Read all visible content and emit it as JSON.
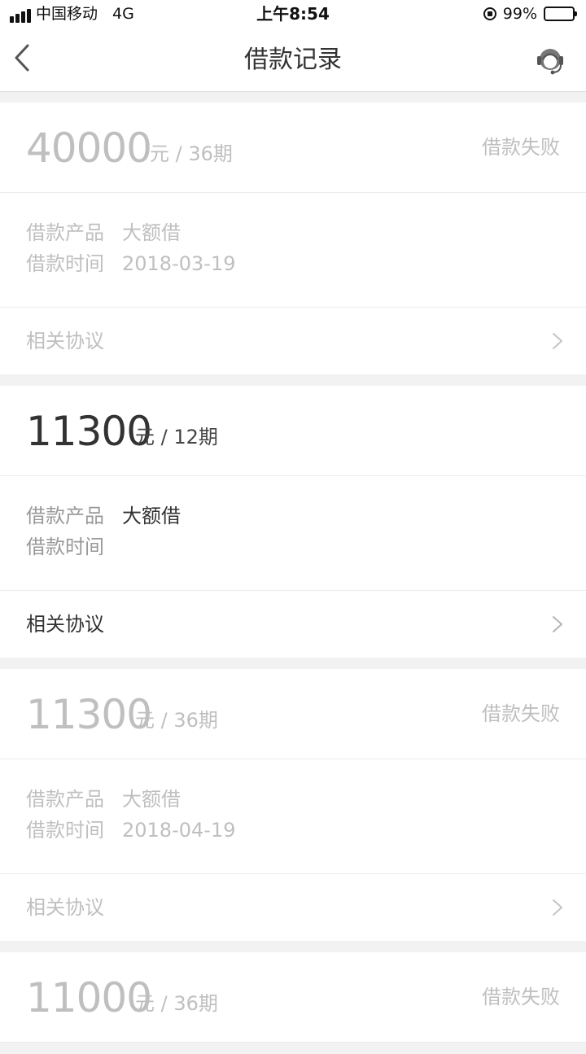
{
  "status_bar": {
    "carrier": "中国移动",
    "network": "4G",
    "time": "上午8:54",
    "battery": "99%"
  },
  "nav": {
    "title": "借款记录",
    "back_icon": "chevron-left-icon",
    "service_icon": "customer-service-icon"
  },
  "labels": {
    "product": "借款产品",
    "time": "借款时间",
    "agreement": "相关协议"
  },
  "records": [
    {
      "amount": "40000",
      "unit": "元 / 36期",
      "status": "借款失败",
      "product": "大额借",
      "date": "2018-03-19"
    },
    {
      "amount": "11300",
      "unit": "元 / 12期",
      "status": "",
      "product": "大额借",
      "date": ""
    },
    {
      "amount": "11300",
      "unit": "元 / 36期",
      "status": "借款失败",
      "product": "大额借",
      "date": "2018-04-19"
    },
    {
      "amount": "11000",
      "unit": "元 / 36期",
      "status": "借款失败"
    }
  ]
}
